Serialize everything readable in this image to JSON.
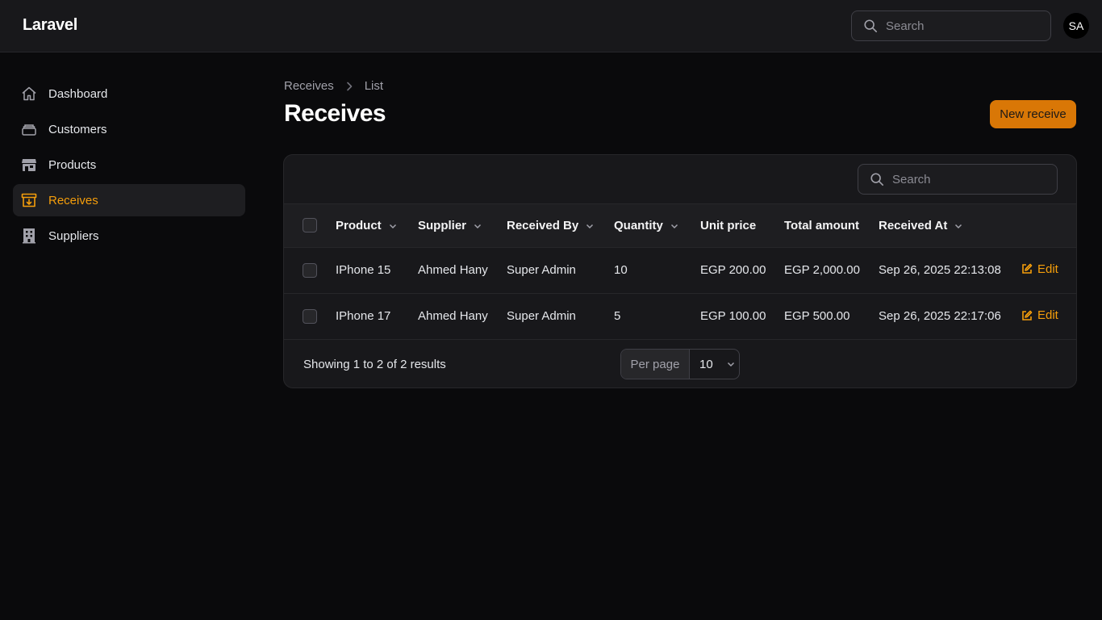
{
  "app": {
    "brand": "Laravel",
    "user_initials": "SA"
  },
  "search": {
    "placeholder": "Search"
  },
  "sidebar": {
    "items": [
      {
        "label": "Dashboard",
        "icon": "home-icon"
      },
      {
        "label": "Customers",
        "icon": "stack-icon"
      },
      {
        "label": "Products",
        "icon": "store-icon"
      },
      {
        "label": "Receives",
        "icon": "archive-in-icon",
        "active": true
      },
      {
        "label": "Suppliers",
        "icon": "building-icon"
      }
    ]
  },
  "breadcrumb": {
    "parent": "Receives",
    "current": "List"
  },
  "page": {
    "title": "Receives",
    "new_button": "New receive"
  },
  "table": {
    "search_placeholder": "Search",
    "columns": [
      "Product",
      "Supplier",
      "Received By",
      "Quantity",
      "Unit price",
      "Total amount",
      "Received At"
    ],
    "rows": [
      {
        "product": "IPhone 15",
        "supplier": "Ahmed Hany",
        "received_by": "Super Admin",
        "quantity": "10",
        "unit_price": "EGP 200.00",
        "total": "EGP 2,000.00",
        "received_at": "Sep 26, 2025 22:13:08",
        "action": "Edit"
      },
      {
        "product": "IPhone 17",
        "supplier": "Ahmed Hany",
        "received_by": "Super Admin",
        "quantity": "5",
        "unit_price": "EGP 100.00",
        "total": "EGP 500.00",
        "received_at": "Sep 26, 2025 22:17:06",
        "action": "Edit"
      }
    ],
    "footer": {
      "results_text": "Showing 1 to 2 of 2 results",
      "per_page_label": "Per page",
      "per_page_value": "10"
    }
  },
  "colors": {
    "accent": "#f59e0b",
    "button": "#d97706",
    "background": "#0a0a0c",
    "surface": "#18181b"
  }
}
